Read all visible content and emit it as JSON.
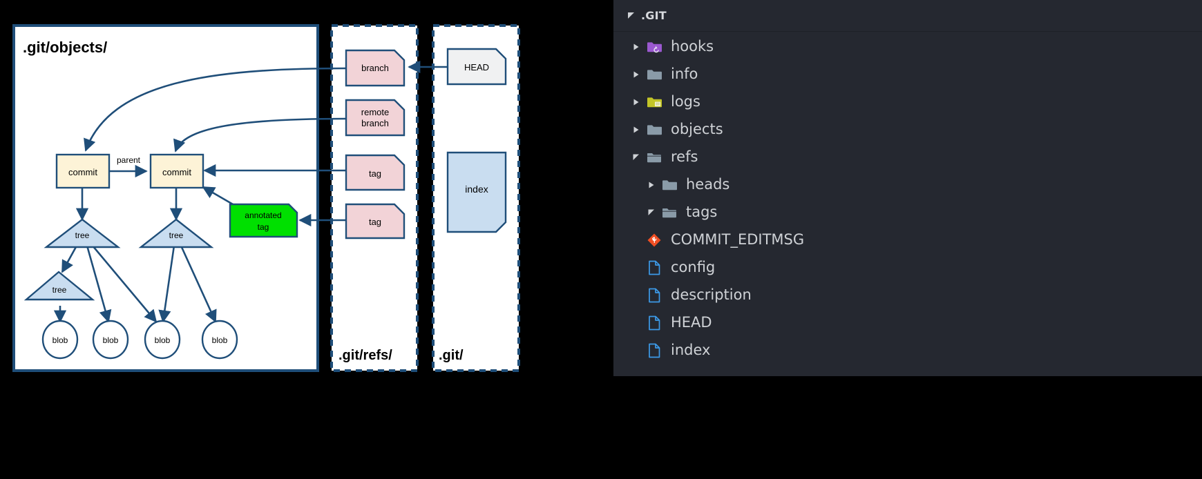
{
  "diagram": {
    "panels": [
      {
        "id": "objects",
        "label": ".git/objects/",
        "border": "solid"
      },
      {
        "id": "refs",
        "label": ".git/refs/",
        "border": "dashed"
      },
      {
        "id": "git",
        "label": ".git/",
        "border": "dashed"
      }
    ],
    "nodes": [
      {
        "id": "commit1",
        "label": "commit",
        "shape": "rect",
        "fill": "#fdf3d7"
      },
      {
        "id": "commit2",
        "label": "commit",
        "shape": "rect",
        "fill": "#fdf3d7"
      },
      {
        "id": "tree1",
        "label": "tree",
        "shape": "triangle",
        "fill": "#c9ddf0"
      },
      {
        "id": "tree2",
        "label": "tree",
        "shape": "triangle",
        "fill": "#c9ddf0"
      },
      {
        "id": "tree3",
        "label": "tree",
        "shape": "triangle",
        "fill": "#c9ddf0"
      },
      {
        "id": "blob1",
        "label": "blob",
        "shape": "ellipse",
        "fill": "#ffffff"
      },
      {
        "id": "blob2",
        "label": "blob",
        "shape": "ellipse",
        "fill": "#ffffff"
      },
      {
        "id": "blob3",
        "label": "blob",
        "shape": "ellipse",
        "fill": "#ffffff"
      },
      {
        "id": "blob4",
        "label": "blob",
        "shape": "ellipse",
        "fill": "#ffffff"
      },
      {
        "id": "annotated_tag",
        "label": "annotated tag",
        "shape": "note",
        "fill": "#00e000"
      },
      {
        "id": "branch",
        "label": "branch",
        "shape": "note",
        "fill": "#f2d3d7"
      },
      {
        "id": "remote_branch",
        "label": "remote branch",
        "shape": "note",
        "fill": "#f2d3d7"
      },
      {
        "id": "tag1",
        "label": "tag",
        "shape": "note",
        "fill": "#f2d3d7"
      },
      {
        "id": "tag2",
        "label": "tag",
        "shape": "note",
        "fill": "#f2d3d7"
      },
      {
        "id": "head",
        "label": "HEAD",
        "shape": "note",
        "fill": "#f0f1f2"
      },
      {
        "id": "index",
        "label": "index",
        "shape": "note",
        "fill": "#c9ddf0"
      }
    ],
    "edge_labels": {
      "parent": "parent"
    },
    "colors": {
      "stroke": "#1f4e79",
      "commit_fill": "#fdf3d7",
      "tree_fill": "#c9ddf0",
      "ref_fill": "#f2d3d7",
      "annotated_fill": "#00e000",
      "head_fill": "#f0f1f2",
      "index_fill": "#c9ddf0",
      "panel_bg": "#ffffff",
      "background": "#000000"
    }
  },
  "file_tree": {
    "header": {
      "title": ".GIT",
      "caret": "expanded"
    },
    "items": [
      {
        "label": "hooks",
        "type": "folder",
        "caret": "collapsed",
        "indent": 0,
        "icon": "folder-hooks-icon",
        "color": "#9b59d0",
        "state": "closed"
      },
      {
        "label": "info",
        "type": "folder",
        "caret": "collapsed",
        "indent": 0,
        "icon": "folder-icon",
        "color": "#8a9ba8",
        "state": "closed"
      },
      {
        "label": "logs",
        "type": "folder",
        "caret": "collapsed",
        "indent": 0,
        "icon": "folder-logs-icon",
        "color": "#c3c527",
        "state": "closed"
      },
      {
        "label": "objects",
        "type": "folder",
        "caret": "collapsed",
        "indent": 0,
        "icon": "folder-icon",
        "color": "#8a9ba8",
        "state": "closed"
      },
      {
        "label": "refs",
        "type": "folder",
        "caret": "expanded",
        "indent": 0,
        "icon": "folder-open-icon",
        "color": "#8a9ba8",
        "state": "open"
      },
      {
        "label": "heads",
        "type": "folder",
        "caret": "collapsed",
        "indent": 1,
        "icon": "folder-icon",
        "color": "#8a9ba8",
        "state": "closed"
      },
      {
        "label": "tags",
        "type": "folder",
        "caret": "expanded",
        "indent": 1,
        "icon": "folder-open-icon",
        "color": "#8a9ba8",
        "state": "open"
      },
      {
        "label": "COMMIT_EDITMSG",
        "type": "file",
        "caret": "none",
        "indent": 0,
        "icon": "git-file-icon",
        "color": "#f04e23",
        "state": "none"
      },
      {
        "label": "config",
        "type": "file",
        "caret": "none",
        "indent": 0,
        "icon": "file-icon",
        "color": "#3c9ae8",
        "state": "none"
      },
      {
        "label": "description",
        "type": "file",
        "caret": "none",
        "indent": 0,
        "icon": "file-icon",
        "color": "#3c9ae8",
        "state": "none"
      },
      {
        "label": "HEAD",
        "type": "file",
        "caret": "none",
        "indent": 0,
        "icon": "file-icon",
        "color": "#3c9ae8",
        "state": "none"
      },
      {
        "label": "index",
        "type": "file",
        "caret": "none",
        "indent": 0,
        "icon": "file-icon",
        "color": "#3c9ae8",
        "state": "none"
      }
    ],
    "colors": {
      "background": "#252830",
      "text": "#cfd2d6",
      "header_text": "#d8dade",
      "caret": "#cfd2d6"
    }
  }
}
